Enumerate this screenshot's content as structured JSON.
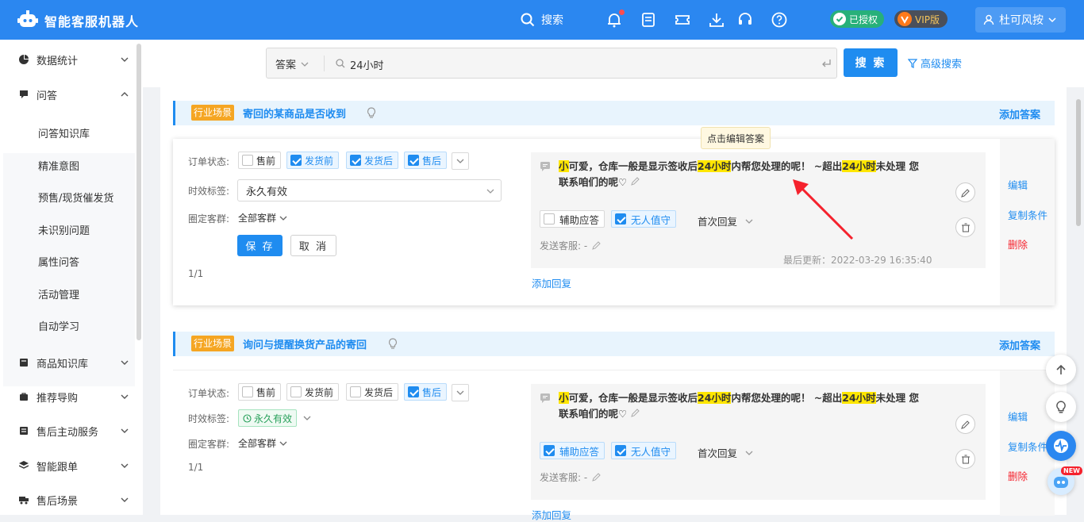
{
  "header": {
    "app_title": "智能客服机器人",
    "search_label": "搜索",
    "authorized_label": "已授权",
    "vip_label": "VIP版",
    "user_name": "杜可风按"
  },
  "sidebar": {
    "items": [
      {
        "label": "数据统计",
        "icon": "pie-chart-icon"
      },
      {
        "label": "问答",
        "icon": "chat-icon"
      },
      {
        "label": "商品知识库",
        "icon": "box-icon"
      },
      {
        "label": "推荐导购",
        "icon": "bag-icon"
      },
      {
        "label": "售后主动服务",
        "icon": "service-icon"
      },
      {
        "label": "智能跟单",
        "icon": "layers-icon"
      },
      {
        "label": "售后场景",
        "icon": "truck-icon"
      }
    ],
    "sub_items": [
      "问答知识库",
      "精准意图",
      "预售/现货催发货",
      "未识别问题",
      "属性问答",
      "活动管理",
      "自动学习"
    ]
  },
  "search": {
    "type_label": "答案",
    "query": "24小时",
    "button": "搜 索",
    "advanced": "高级搜索"
  },
  "tooltip": "点击编辑答案",
  "common": {
    "tag_industry": "行业场景",
    "add_answer": "添加答案",
    "label_order_status": "订单状态:",
    "label_valid_tag": "时效标签:",
    "label_customer_group": "圈定客群:",
    "status_options": [
      "售前",
      "发货前",
      "发货后",
      "售后"
    ],
    "all_groups": "全部客群",
    "save": "保 存",
    "cancel": "取 消",
    "assist_reply": "辅助应答",
    "unattended": "无人值守",
    "first_reply": "首次回复",
    "send_cs": "发送客服: -",
    "add_reply": "添加回复",
    "actions": [
      "编辑",
      "复制条件",
      "删除"
    ]
  },
  "sections": [
    {
      "title": "寄回的某商品是否收到",
      "status_checked": [
        false,
        true,
        true,
        true
      ],
      "valid_value": "永久有效",
      "pager": "1/1",
      "reply_parts": [
        "小",
        "可爱，仓库一般是显示签收后",
        "24小时",
        "内帮您处理的呢！ ~超出",
        "24小时",
        "未处理 您联系咱们的呢♡"
      ],
      "assist_checked": false,
      "unattended_checked": true,
      "updated": "最后更新：2022-03-29 16:35:40"
    },
    {
      "title": "询问与提醒换货产品的寄回",
      "status_checked": [
        false,
        false,
        false,
        true
      ],
      "valid_value": "永久有效",
      "pager": "1/1",
      "reply_parts": [
        "小",
        "可爱，仓库一般是显示签收后",
        "24小时",
        "内帮您处理的呢！ ~超出",
        "24小时",
        "未处理 您联系咱们的呢♡"
      ],
      "assist_checked": true,
      "unattended_checked": true,
      "updated": ""
    }
  ],
  "floating": {
    "new_badge": "NEW"
  },
  "colors": {
    "primary": "#2b87f0",
    "accent": "#1f8cf0",
    "industry_tag": "#f5a623",
    "highlight": "#ffe600",
    "danger": "#f5222d"
  }
}
